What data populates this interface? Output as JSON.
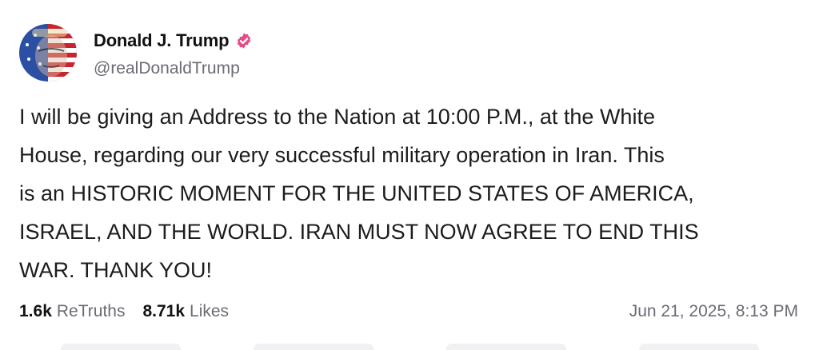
{
  "post": {
    "author": {
      "display_name": "Donald J. Trump",
      "handle": "@realDonaldTrump",
      "verified": true,
      "verified_color": "#e64a8a"
    },
    "text": "I will be giving an Address to the Nation at 10:00 P.M., at the White\nHouse, regarding our very successful military operation in Iran. This\nis an HISTORIC MOMENT FOR THE UNITED STATES OF AMERICA,\nISRAEL, AND THE WORLD. IRAN MUST NOW AGREE TO END THIS\nWAR. THANK YOU!",
    "stats": {
      "retruths_count": "1.6k",
      "retruths_label": "ReTruths",
      "likes_count": "8.71k",
      "likes_label": "Likes"
    },
    "timestamp": "Jun 21, 2025, 8:13 PM"
  },
  "icons": {
    "avatar": "profile-avatar-flag",
    "verified": "verified-badge-icon"
  }
}
